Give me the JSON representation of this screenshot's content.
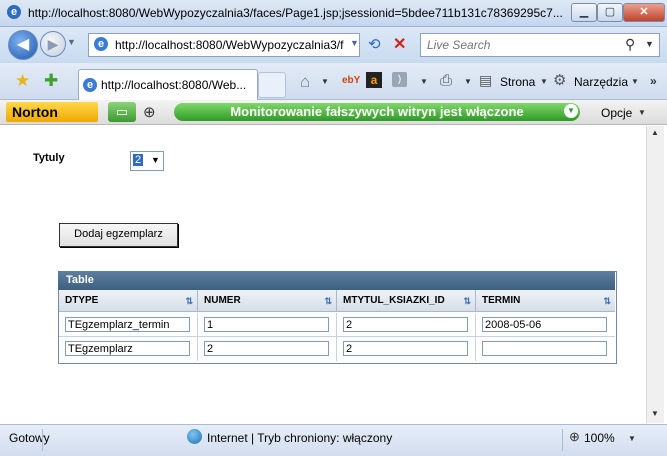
{
  "window": {
    "title": "http://localhost:8080/WebWypozyczalnia3/faces/Page1.jsp;jsessionid=5bdee711b131c78369295c7...",
    "minimize": "▁",
    "maximize": "▢",
    "close": "✕"
  },
  "nav": {
    "address": "http://localhost:8080/WebWypozyczalnia3/f",
    "search_placeholder": "Live Search"
  },
  "tabs": [
    {
      "label": "http://localhost:8080/Web..."
    }
  ],
  "toolbar": {
    "page_label": "Strona",
    "tools_label": "Narzędzia"
  },
  "norton": {
    "logo": "Norton",
    "status": "Monitorowanie fałszywych witryn jest włączone",
    "options": "Opcje"
  },
  "form": {
    "titles_label": "Tytuly",
    "titles_value": "2",
    "add_button": "Dodaj egzemplarz"
  },
  "table": {
    "title": "Table",
    "columns": [
      "DTYPE",
      "NUMER",
      "MTYTUL_KSIAZKI_ID",
      "TERMIN"
    ],
    "rows": [
      [
        "TEgzemplarz_termin",
        "1",
        "2",
        "2008-05-06"
      ],
      [
        "TEgzemplarz",
        "2",
        "2",
        ""
      ]
    ]
  },
  "status": {
    "left": "Gotowy",
    "zone": "Internet | Tryb chroniony: włączony",
    "zoom": "100%"
  }
}
